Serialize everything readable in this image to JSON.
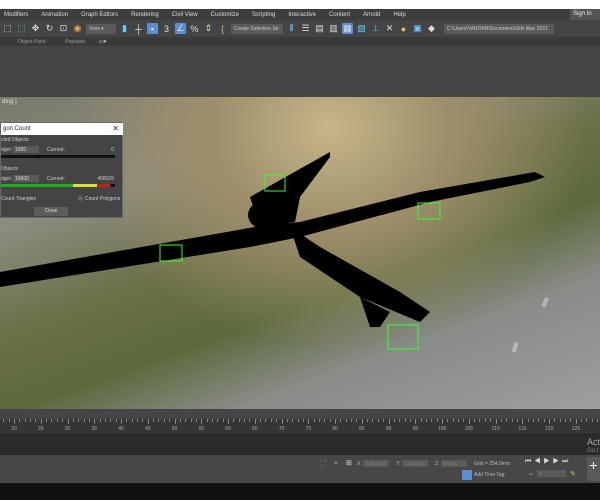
{
  "menu": [
    "Modifiers",
    "Animation",
    "Graph Editors",
    "Rendering",
    "Civil View",
    "Customize",
    "Scripting",
    "Interactive",
    "Content",
    "Arnold",
    "Help"
  ],
  "sign_in": "Sign In",
  "toolbar": {
    "view_dropdown": "View",
    "selection_set": "Create Selection Se",
    "project_path": "C:\\Users\\YARDAN\\Documents\\3ds Max 2021"
  },
  "ribbon": {
    "object_paint": "Object Paint",
    "populate": "Populate"
  },
  "viewport": {
    "label": "ding ]"
  },
  "dialog": {
    "title": "gon Count",
    "selected_group": "cted Objects",
    "selected_budget_label": "dget:",
    "selected_budget": "1000",
    "selected_current_label": "Current:",
    "selected_current": "0",
    "all_group": "Objects",
    "all_budget_label": "dget:",
    "all_budget": "10000",
    "all_current_label": "Current:",
    "all_current": "468025",
    "count_triangles": "Count Triangles",
    "count_polygons": "Count Polygons",
    "close": "Close"
  },
  "timeline": {
    "ticks": [
      "20",
      "25",
      "30",
      "35",
      "40",
      "45",
      "50",
      "55",
      "60",
      "65",
      "70",
      "75",
      "80",
      "85",
      "90",
      "95",
      "100",
      "105",
      "110",
      "115",
      "120",
      "125"
    ]
  },
  "status": {
    "x_label": "X:",
    "x_value": "-107.273m",
    "y_label": "Y:",
    "y_value": "-10332.76",
    "z_label": "Z:",
    "z_value": "0.0mm",
    "grid": "Grid = 254.0mm",
    "add_time_tag": "Add Time Tag",
    "frame": "0",
    "activate": "Act",
    "goto": "Go t"
  },
  "colors": {
    "accent": "#5b8fd1",
    "gizmo": "#33ff33"
  }
}
